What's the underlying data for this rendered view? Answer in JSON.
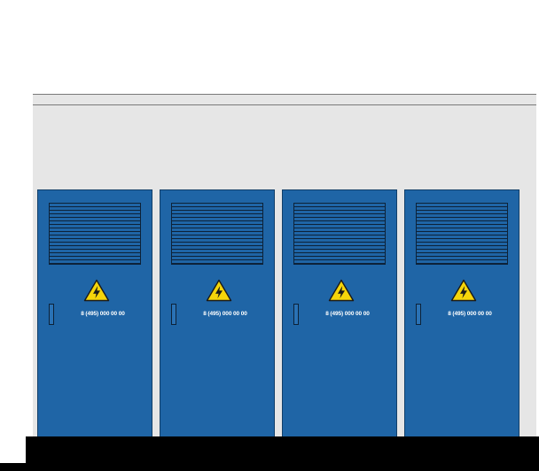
{
  "cabinets": [
    {
      "phone": "8 (495) 000 00 00",
      "icon": "high-voltage-warning-icon"
    },
    {
      "phone": "8 (495) 000 00 00",
      "icon": "high-voltage-warning-icon"
    },
    {
      "phone": "8 (495) 000 00 00",
      "icon": "high-voltage-warning-icon"
    },
    {
      "phone": "8 (495) 000 00 00",
      "icon": "high-voltage-warning-icon"
    }
  ],
  "colors": {
    "cabinet_blue": "#1f65a6",
    "louver_dark": "#0d2238",
    "warning_yellow": "#f5d50a",
    "wall_gray": "#e6e6e6",
    "base_black": "#000000"
  }
}
